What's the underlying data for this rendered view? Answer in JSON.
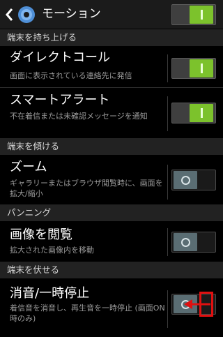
{
  "header": {
    "title": "モーション",
    "master_toggle": true
  },
  "sections": [
    {
      "label": "端末を持ち上げる"
    },
    {
      "label": "端末を傾ける"
    },
    {
      "label": "パンニング"
    },
    {
      "label": "端末を伏せる"
    }
  ],
  "items": [
    {
      "title": "ダイレクトコール",
      "desc": "画面に表示されている連絡先に発信",
      "enabled": true
    },
    {
      "title": "スマートアラート",
      "desc": "不在着信または未確認メッセージを通知",
      "enabled": true
    },
    {
      "title": "ズーム",
      "desc": "ギャラリーまたはブラウザ閲覧時に、画面を拡大/縮小",
      "enabled": false
    },
    {
      "title": "画像を閲覧",
      "desc": "拡大された画像内を移動",
      "enabled": false
    },
    {
      "title": "消音/一時停止",
      "desc": "着信音を消音し、再生音を一時停止 (画面ON時のみ)",
      "enabled": false
    }
  ],
  "annotation": {
    "color": "#e01010",
    "target": "消音/一時停止 toggle"
  }
}
